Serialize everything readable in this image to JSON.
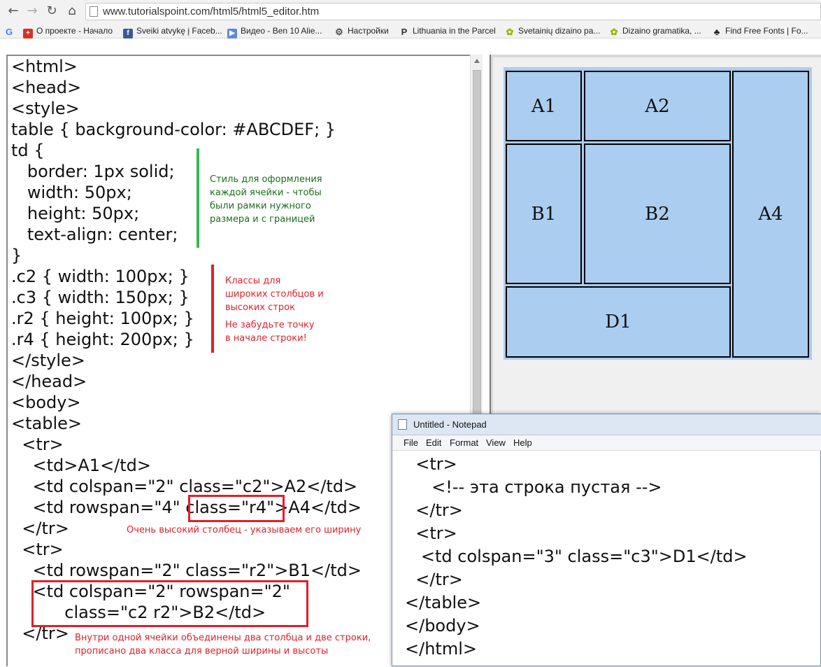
{
  "browser": {
    "url": "www.tutorialspoint.com/html5/html5_editor.htm",
    "bookmarks": [
      "О проекте - Начало",
      "Sveiki atvykę į Faceb...",
      "Видео - Ben 10 Alie...",
      "Настройки",
      "Lithuania in the Parcel",
      "Svetainių dizaino pa...",
      "Dizaino gramatika, ...",
      "Find Free Fonts | Fo..."
    ]
  },
  "editor": {
    "lines": [
      "<html>",
      "<head>",
      "<style>",
      "table { background-color: #ABCDEF; }",
      "td {",
      "   border: 1px solid;",
      "   width: 50px;",
      "   height: 50px;",
      "   text-align: center;",
      "}",
      ".c2 { width: 100px; }",
      ".c3 { width: 150px; }",
      ".r2 { height: 100px; }",
      ".r4 { height: 200px; }",
      "</style>",
      "</head>",
      "<body>",
      "<table>",
      "  <tr>",
      "    <td>A1</td>",
      "    <td colspan=\"2\" class=\"c2\">A2</td>",
      "    <td rowspan=\"4\" class=\"r4\">A4</td>",
      "  </tr>",
      "  <tr>",
      "    <td rowspan=\"2\" class=\"r2\">B1</td>",
      "    <td colspan=\"2\" rowspan=\"2\"",
      "          class=\"c2 r2\">B2</td>",
      "  </tr>"
    ],
    "notes": {
      "td_style": "Стиль для оформления\nкаждой ячейки - чтобы\nбыли рамки нужного\nразмера и с границей",
      "classes": "Классы для\nшироких столбцов и\nвысоких строк",
      "dot_warning": "Не забудьте точку\nв начале строки!",
      "tall_column": "Очень высокий столбец - указываем его ширину",
      "merged_cell": "Внутри одной ячейки объединены два столбца и две строки,\nпрописано два класса для верной ширины и высоты"
    }
  },
  "preview": {
    "table_bg": "#ABCDEF",
    "cells": [
      "A1",
      "A2",
      "A4",
      "B1",
      "B2",
      "D1"
    ]
  },
  "notepad": {
    "title": "Untitled - Notepad",
    "menu": [
      "File",
      "Edit",
      "Format",
      "View",
      "Help"
    ],
    "lines": [
      "  <tr>",
      "     <!-- эта строка пустая -->",
      "  </tr>",
      "  <tr>",
      "   <td colspan=\"3\" class=\"c3\">D1</td>",
      "  </tr>",
      "</table>",
      "</body>",
      "</html>"
    ]
  }
}
